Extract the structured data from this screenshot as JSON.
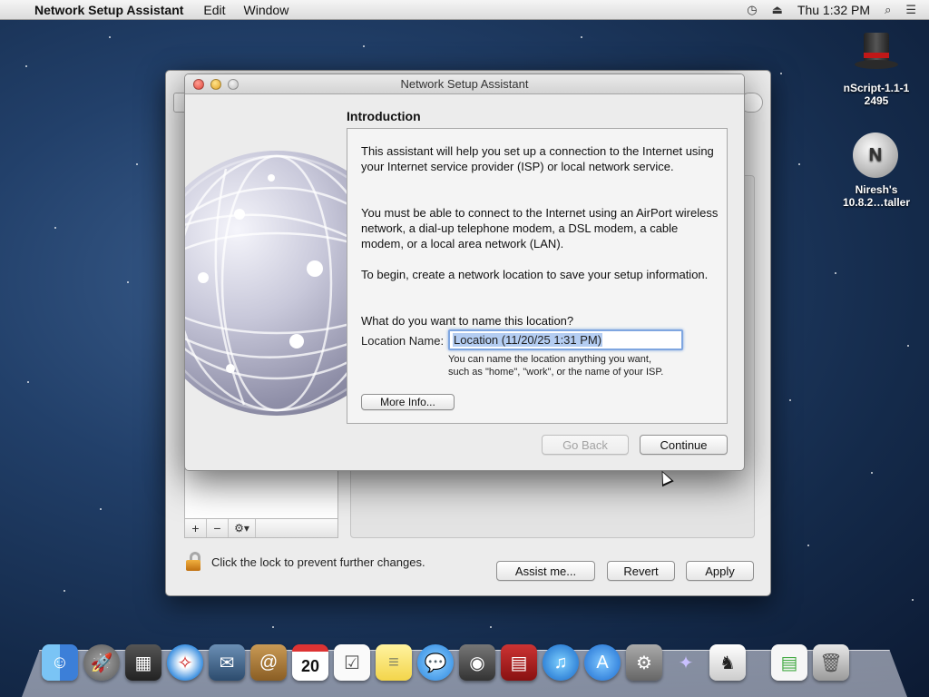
{
  "menubar": {
    "app_name": "Network Setup Assistant",
    "items": [
      "Edit",
      "Window"
    ],
    "clock": "Thu 1:32 PM"
  },
  "desktop": {
    "icons": [
      {
        "label": "nScript-1.1-1\n2495",
        "icon": "top-hat-icon"
      },
      {
        "label": "Niresh's\n10.8.2…taller",
        "icon": "disk-image-icon"
      }
    ]
  },
  "dialog": {
    "title": "Network Setup Assistant",
    "heading": "Introduction",
    "paragraph1": "This assistant will help you set up a connection to the Internet using your Internet service provider (ISP) or local network service.",
    "paragraph2": "You must be able to connect to the Internet using an AirPort wireless network, a dial-up telephone modem, a DSL modem, a cable modem, or a local area network (LAN).",
    "paragraph3": "To begin, create a network location to save your setup information.",
    "question": "What do you want to name this location?",
    "location_label": "Location Name:",
    "location_value": "Location (11/20/25 1:31 PM)",
    "hint_line1": "You can name the location anything you want,",
    "hint_line2": "such as \"home\", \"work\", or the name of your ISP.",
    "more_info": "More Info...",
    "go_back": "Go Back",
    "continue": "Continue"
  },
  "network_window": {
    "lock_text": "Click the lock to prevent further changes.",
    "assist": "Assist me...",
    "revert": "Revert",
    "apply": "Apply",
    "add": "+",
    "remove": "−",
    "gear": "⚙▾"
  },
  "dock": {
    "items": [
      "Finder",
      "Launchpad",
      "Mission Control",
      "Safari",
      "Mail",
      "Contacts",
      "Calendar",
      "Reminders",
      "Notes",
      "Messages",
      "FaceTime",
      "Photo Booth",
      "iTunes",
      "App Store",
      "System Preferences",
      "Wizard",
      "Butler",
      "Document",
      "Trash"
    ],
    "calendar_day": "20"
  },
  "colors": {
    "accent_selection": "#b4cdf2",
    "focus_ring": "#7fa6e0"
  }
}
